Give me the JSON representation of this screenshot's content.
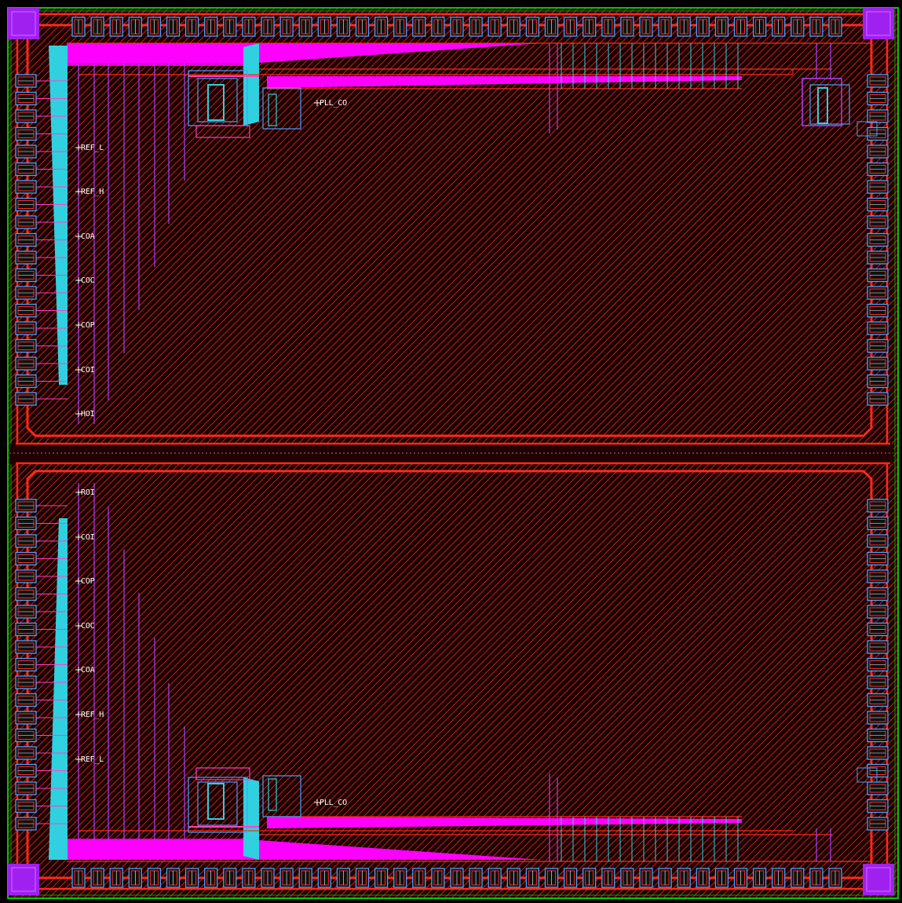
{
  "colors": {
    "background": "#000000",
    "die_fill": "#1a0000",
    "hatch": "#e8261c",
    "boundary": "#00c800",
    "metal_red": "#ff2a1a",
    "metal_magenta": "#ff00ff",
    "metal_cyan": "#30d0e0",
    "blue_outline": "#4aa0ff",
    "purple": "#b040ff",
    "corner": "#a020f0",
    "label": "#ffffff"
  },
  "pins": {
    "top": [
      {
        "id": "ref_l",
        "label": "REF_L"
      },
      {
        "id": "ref_h",
        "label": "REF_H"
      },
      {
        "id": "coa",
        "label": "COA"
      },
      {
        "id": "coc",
        "label": "COC"
      },
      {
        "id": "cop",
        "label": "COP"
      },
      {
        "id": "coi",
        "label": "COI"
      },
      {
        "id": "hoi",
        "label": "HOI"
      }
    ],
    "bottom": [
      {
        "id": "roi",
        "label": "ROI"
      },
      {
        "id": "coi",
        "label": "COI"
      },
      {
        "id": "cop",
        "label": "COP"
      },
      {
        "id": "coc",
        "label": "COC"
      },
      {
        "id": "coa",
        "label": "COA"
      },
      {
        "id": "ref_h",
        "label": "REF_H"
      },
      {
        "id": "ref_l",
        "label": "REF_L"
      }
    ],
    "pll_top": "PLL_CO",
    "pll_bottom": "PLL_CO"
  }
}
